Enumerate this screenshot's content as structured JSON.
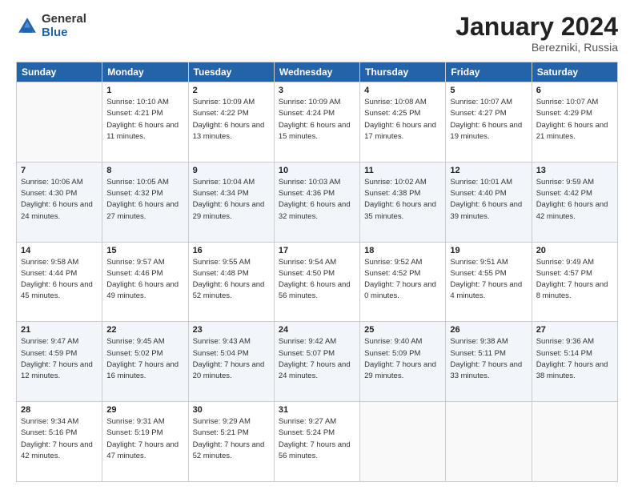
{
  "logo": {
    "general": "General",
    "blue": "Blue"
  },
  "title": "January 2024",
  "subtitle": "Berezniki, Russia",
  "days_of_week": [
    "Sunday",
    "Monday",
    "Tuesday",
    "Wednesday",
    "Thursday",
    "Friday",
    "Saturday"
  ],
  "weeks": [
    [
      {
        "day": "",
        "sunrise": "",
        "sunset": "",
        "daylight": ""
      },
      {
        "day": "1",
        "sunrise": "Sunrise: 10:10 AM",
        "sunset": "Sunset: 4:21 PM",
        "daylight": "Daylight: 6 hours and 11 minutes."
      },
      {
        "day": "2",
        "sunrise": "Sunrise: 10:09 AM",
        "sunset": "Sunset: 4:22 PM",
        "daylight": "Daylight: 6 hours and 13 minutes."
      },
      {
        "day": "3",
        "sunrise": "Sunrise: 10:09 AM",
        "sunset": "Sunset: 4:24 PM",
        "daylight": "Daylight: 6 hours and 15 minutes."
      },
      {
        "day": "4",
        "sunrise": "Sunrise: 10:08 AM",
        "sunset": "Sunset: 4:25 PM",
        "daylight": "Daylight: 6 hours and 17 minutes."
      },
      {
        "day": "5",
        "sunrise": "Sunrise: 10:07 AM",
        "sunset": "Sunset: 4:27 PM",
        "daylight": "Daylight: 6 hours and 19 minutes."
      },
      {
        "day": "6",
        "sunrise": "Sunrise: 10:07 AM",
        "sunset": "Sunset: 4:29 PM",
        "daylight": "Daylight: 6 hours and 21 minutes."
      }
    ],
    [
      {
        "day": "7",
        "sunrise": "Sunrise: 10:06 AM",
        "sunset": "Sunset: 4:30 PM",
        "daylight": "Daylight: 6 hours and 24 minutes."
      },
      {
        "day": "8",
        "sunrise": "Sunrise: 10:05 AM",
        "sunset": "Sunset: 4:32 PM",
        "daylight": "Daylight: 6 hours and 27 minutes."
      },
      {
        "day": "9",
        "sunrise": "Sunrise: 10:04 AM",
        "sunset": "Sunset: 4:34 PM",
        "daylight": "Daylight: 6 hours and 29 minutes."
      },
      {
        "day": "10",
        "sunrise": "Sunrise: 10:03 AM",
        "sunset": "Sunset: 4:36 PM",
        "daylight": "Daylight: 6 hours and 32 minutes."
      },
      {
        "day": "11",
        "sunrise": "Sunrise: 10:02 AM",
        "sunset": "Sunset: 4:38 PM",
        "daylight": "Daylight: 6 hours and 35 minutes."
      },
      {
        "day": "12",
        "sunrise": "Sunrise: 10:01 AM",
        "sunset": "Sunset: 4:40 PM",
        "daylight": "Daylight: 6 hours and 39 minutes."
      },
      {
        "day": "13",
        "sunrise": "Sunrise: 9:59 AM",
        "sunset": "Sunset: 4:42 PM",
        "daylight": "Daylight: 6 hours and 42 minutes."
      }
    ],
    [
      {
        "day": "14",
        "sunrise": "Sunrise: 9:58 AM",
        "sunset": "Sunset: 4:44 PM",
        "daylight": "Daylight: 6 hours and 45 minutes."
      },
      {
        "day": "15",
        "sunrise": "Sunrise: 9:57 AM",
        "sunset": "Sunset: 4:46 PM",
        "daylight": "Daylight: 6 hours and 49 minutes."
      },
      {
        "day": "16",
        "sunrise": "Sunrise: 9:55 AM",
        "sunset": "Sunset: 4:48 PM",
        "daylight": "Daylight: 6 hours and 52 minutes."
      },
      {
        "day": "17",
        "sunrise": "Sunrise: 9:54 AM",
        "sunset": "Sunset: 4:50 PM",
        "daylight": "Daylight: 6 hours and 56 minutes."
      },
      {
        "day": "18",
        "sunrise": "Sunrise: 9:52 AM",
        "sunset": "Sunset: 4:52 PM",
        "daylight": "Daylight: 7 hours and 0 minutes."
      },
      {
        "day": "19",
        "sunrise": "Sunrise: 9:51 AM",
        "sunset": "Sunset: 4:55 PM",
        "daylight": "Daylight: 7 hours and 4 minutes."
      },
      {
        "day": "20",
        "sunrise": "Sunrise: 9:49 AM",
        "sunset": "Sunset: 4:57 PM",
        "daylight": "Daylight: 7 hours and 8 minutes."
      }
    ],
    [
      {
        "day": "21",
        "sunrise": "Sunrise: 9:47 AM",
        "sunset": "Sunset: 4:59 PM",
        "daylight": "Daylight: 7 hours and 12 minutes."
      },
      {
        "day": "22",
        "sunrise": "Sunrise: 9:45 AM",
        "sunset": "Sunset: 5:02 PM",
        "daylight": "Daylight: 7 hours and 16 minutes."
      },
      {
        "day": "23",
        "sunrise": "Sunrise: 9:43 AM",
        "sunset": "Sunset: 5:04 PM",
        "daylight": "Daylight: 7 hours and 20 minutes."
      },
      {
        "day": "24",
        "sunrise": "Sunrise: 9:42 AM",
        "sunset": "Sunset: 5:07 PM",
        "daylight": "Daylight: 7 hours and 24 minutes."
      },
      {
        "day": "25",
        "sunrise": "Sunrise: 9:40 AM",
        "sunset": "Sunset: 5:09 PM",
        "daylight": "Daylight: 7 hours and 29 minutes."
      },
      {
        "day": "26",
        "sunrise": "Sunrise: 9:38 AM",
        "sunset": "Sunset: 5:11 PM",
        "daylight": "Daylight: 7 hours and 33 minutes."
      },
      {
        "day": "27",
        "sunrise": "Sunrise: 9:36 AM",
        "sunset": "Sunset: 5:14 PM",
        "daylight": "Daylight: 7 hours and 38 minutes."
      }
    ],
    [
      {
        "day": "28",
        "sunrise": "Sunrise: 9:34 AM",
        "sunset": "Sunset: 5:16 PM",
        "daylight": "Daylight: 7 hours and 42 minutes."
      },
      {
        "day": "29",
        "sunrise": "Sunrise: 9:31 AM",
        "sunset": "Sunset: 5:19 PM",
        "daylight": "Daylight: 7 hours and 47 minutes."
      },
      {
        "day": "30",
        "sunrise": "Sunrise: 9:29 AM",
        "sunset": "Sunset: 5:21 PM",
        "daylight": "Daylight: 7 hours and 52 minutes."
      },
      {
        "day": "31",
        "sunrise": "Sunrise: 9:27 AM",
        "sunset": "Sunset: 5:24 PM",
        "daylight": "Daylight: 7 hours and 56 minutes."
      },
      {
        "day": "",
        "sunrise": "",
        "sunset": "",
        "daylight": ""
      },
      {
        "day": "",
        "sunrise": "",
        "sunset": "",
        "daylight": ""
      },
      {
        "day": "",
        "sunrise": "",
        "sunset": "",
        "daylight": ""
      }
    ]
  ]
}
